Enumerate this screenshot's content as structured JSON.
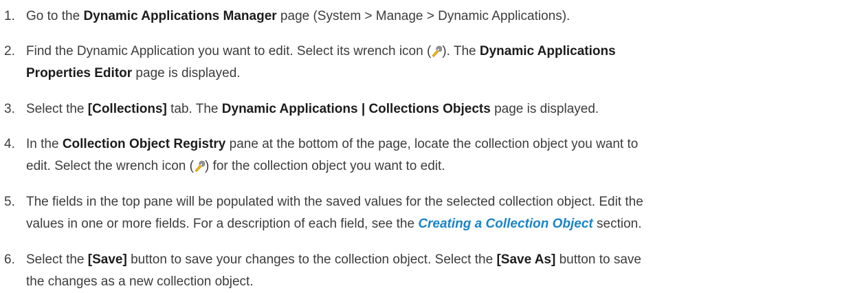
{
  "steps": [
    {
      "number": "1.",
      "lines": [
        [
          {
            "t": "text",
            "v": "Go to the "
          },
          {
            "t": "bold",
            "v": "Dynamic Applications Manager"
          },
          {
            "t": "text",
            "v": " page (System > Manage > Dynamic Applications)."
          }
        ]
      ]
    },
    {
      "number": "2.",
      "lines": [
        [
          {
            "t": "text",
            "v": "Find the Dynamic Application you want to edit. Select its wrench icon ("
          },
          {
            "t": "icon",
            "v": "wrench-icon"
          },
          {
            "t": "text",
            "v": "). The "
          },
          {
            "t": "bold",
            "v": "Dynamic Applications"
          }
        ],
        [
          {
            "t": "bold",
            "v": "Properties Editor"
          },
          {
            "t": "text",
            "v": " page is displayed."
          }
        ]
      ]
    },
    {
      "number": "3.",
      "lines": [
        [
          {
            "t": "text",
            "v": "Select the "
          },
          {
            "t": "bold",
            "v": "[Collections]"
          },
          {
            "t": "text",
            "v": " tab. The "
          },
          {
            "t": "bold",
            "v": "Dynamic Applications | Collections Objects"
          },
          {
            "t": "text",
            "v": " page is displayed."
          }
        ]
      ]
    },
    {
      "number": "4.",
      "lines": [
        [
          {
            "t": "text",
            "v": "In the "
          },
          {
            "t": "bold",
            "v": "Collection Object Registry"
          },
          {
            "t": "text",
            "v": " pane at the bottom of the page, locate the collection object you want to"
          }
        ],
        [
          {
            "t": "text",
            "v": "edit. Select the wrench icon ("
          },
          {
            "t": "icon",
            "v": "wrench-icon"
          },
          {
            "t": "text",
            "v": ") for the collection object you want to edit."
          }
        ]
      ]
    },
    {
      "number": "5.",
      "lines": [
        [
          {
            "t": "text",
            "v": "The fields in the top pane will be populated with the saved values for the selected collection object. Edit the"
          }
        ],
        [
          {
            "t": "text",
            "v": "values in one or more fields. For a description of each field, see the "
          },
          {
            "t": "link",
            "v": "Creating a Collection Object"
          },
          {
            "t": "text",
            "v": " section."
          }
        ]
      ]
    },
    {
      "number": "6.",
      "lines": [
        [
          {
            "t": "text",
            "v": "Select the "
          },
          {
            "t": "bold",
            "v": "[Save]"
          },
          {
            "t": "text",
            "v": " button to save your changes to the collection object. Select the "
          },
          {
            "t": "bold",
            "v": "[Save As]"
          },
          {
            "t": "text",
            "v": " button to save"
          }
        ],
        [
          {
            "t": "text",
            "v": "the changes as a new collection object."
          }
        ]
      ]
    }
  ]
}
